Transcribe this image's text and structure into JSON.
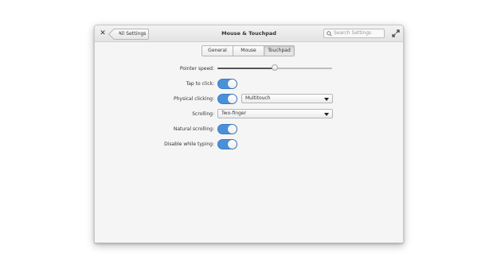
{
  "window": {
    "title": "Mouse & Touchpad",
    "back_label": "All Settings",
    "search_placeholder": "Search Settings"
  },
  "tabs": [
    {
      "label": "General",
      "active": false
    },
    {
      "label": "Mouse",
      "active": false
    },
    {
      "label": "Touchpad",
      "active": true
    }
  ],
  "settings": {
    "pointer_speed": {
      "label": "Pointer speed:",
      "value_fraction": 0.5
    },
    "tap_to_click": {
      "label": "Tap to click:",
      "enabled": true
    },
    "physical_clicking": {
      "label": "Physical clicking:",
      "enabled": true,
      "selected": "Multitouch"
    },
    "scrolling": {
      "label": "Scrolling:",
      "selected": "Two-finger"
    },
    "natural_scrolling": {
      "label": "Natural scrolling:",
      "enabled": true
    },
    "disable_while_typing": {
      "label": "Disable while typing:",
      "enabled": true
    }
  },
  "colors": {
    "accent": "#4a90d9",
    "window_bg": "#f5f5f5"
  },
  "icons": {
    "close": "close-icon",
    "search": "search-icon",
    "maximize": "maximize-icon",
    "dropdown": "chevron-down-icon"
  }
}
